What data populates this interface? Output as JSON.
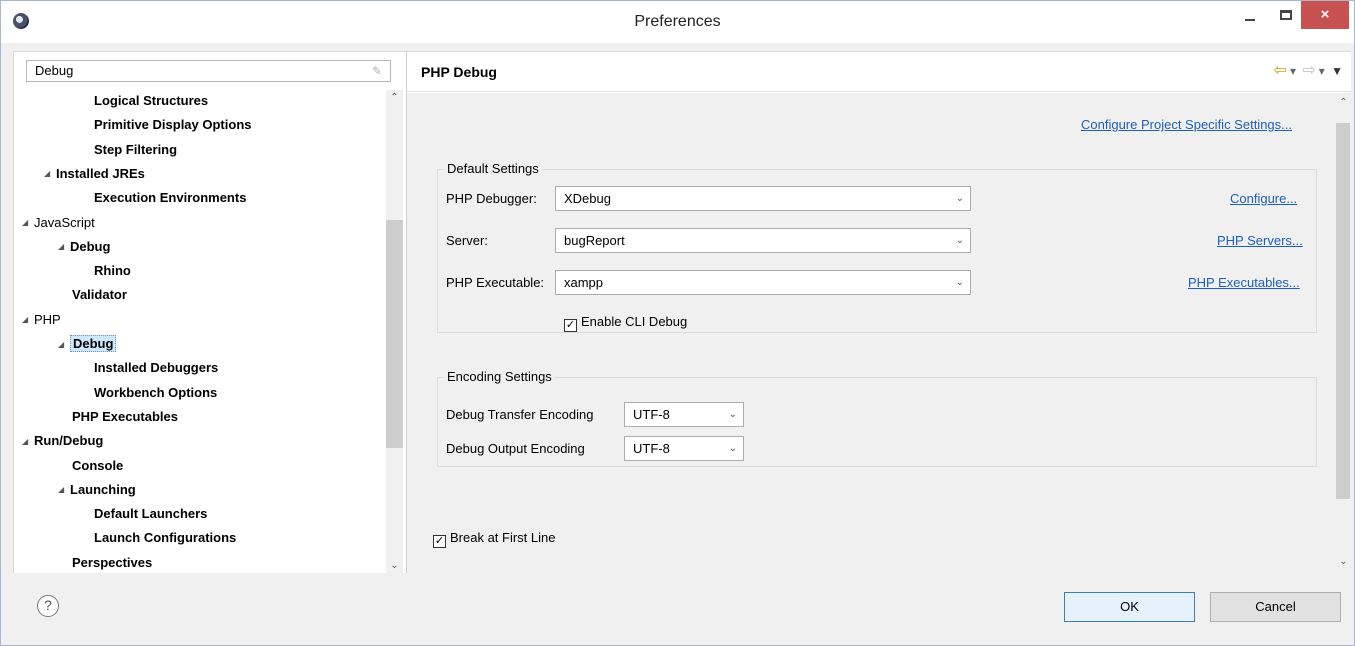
{
  "window": {
    "title": "Preferences",
    "close_label": "×"
  },
  "sidebar": {
    "filter_value": "Debug",
    "tree": [
      {
        "label": "Logical Structures",
        "bold": true,
        "arrow": ""
      },
      {
        "label": "Primitive Display Options",
        "bold": true,
        "arrow": ""
      },
      {
        "label": "Step Filtering",
        "bold": true,
        "arrow": ""
      },
      {
        "label": "Installed JREs",
        "bold": true,
        "arrow": "◢"
      },
      {
        "label": "Execution Environments",
        "bold": true,
        "arrow": ""
      },
      {
        "label": "JavaScript",
        "bold": false,
        "arrow": "◢"
      },
      {
        "label": "Debug",
        "bold": true,
        "arrow": "◢"
      },
      {
        "label": "Rhino",
        "bold": true,
        "arrow": ""
      },
      {
        "label": "Validator",
        "bold": true,
        "arrow": ""
      },
      {
        "label": "PHP",
        "bold": false,
        "arrow": "◢"
      },
      {
        "label": "Debug",
        "bold": true,
        "arrow": "◢",
        "selected": true
      },
      {
        "label": "Installed Debuggers",
        "bold": true,
        "arrow": ""
      },
      {
        "label": "Workbench Options",
        "bold": true,
        "arrow": ""
      },
      {
        "label": "PHP Executables",
        "bold": true,
        "arrow": ""
      },
      {
        "label": "Run/Debug",
        "bold": true,
        "arrow": "◢"
      },
      {
        "label": "Console",
        "bold": true,
        "arrow": ""
      },
      {
        "label": "Launching",
        "bold": true,
        "arrow": "◢"
      },
      {
        "label": "Default Launchers",
        "bold": true,
        "arrow": ""
      },
      {
        "label": "Launch Configurations",
        "bold": true,
        "arrow": ""
      },
      {
        "label": "Perspectives",
        "bold": true,
        "arrow": ""
      }
    ]
  },
  "page": {
    "title": "PHP Debug",
    "project_settings_link": "Configure Project Specific Settings...",
    "default_settings": {
      "title": "Default Settings",
      "debugger_label": "PHP Debugger:",
      "debugger_value": "XDebug",
      "debugger_link": "Configure...",
      "server_label": "Server:",
      "server_value": "bugReport",
      "server_link": "PHP Servers...",
      "executable_label": "PHP Executable:",
      "executable_value": "xampp",
      "executable_link": "PHP Executables...",
      "cli_debug_label": "Enable CLI Debug",
      "cli_debug_checked": true
    },
    "encoding_settings": {
      "title": "Encoding Settings",
      "transfer_label": "Debug Transfer Encoding",
      "transfer_value": "UTF-8",
      "output_label": "Debug Output Encoding",
      "output_value": "UTF-8"
    },
    "break_first_line_label": "Break at First Line",
    "break_first_line_checked": true
  },
  "footer": {
    "help_label": "?",
    "ok_label": "OK",
    "cancel_label": "Cancel"
  },
  "colors": {
    "link": "#1e5fb8",
    "close_button": "#c75050",
    "selection": "#cde8ff"
  }
}
